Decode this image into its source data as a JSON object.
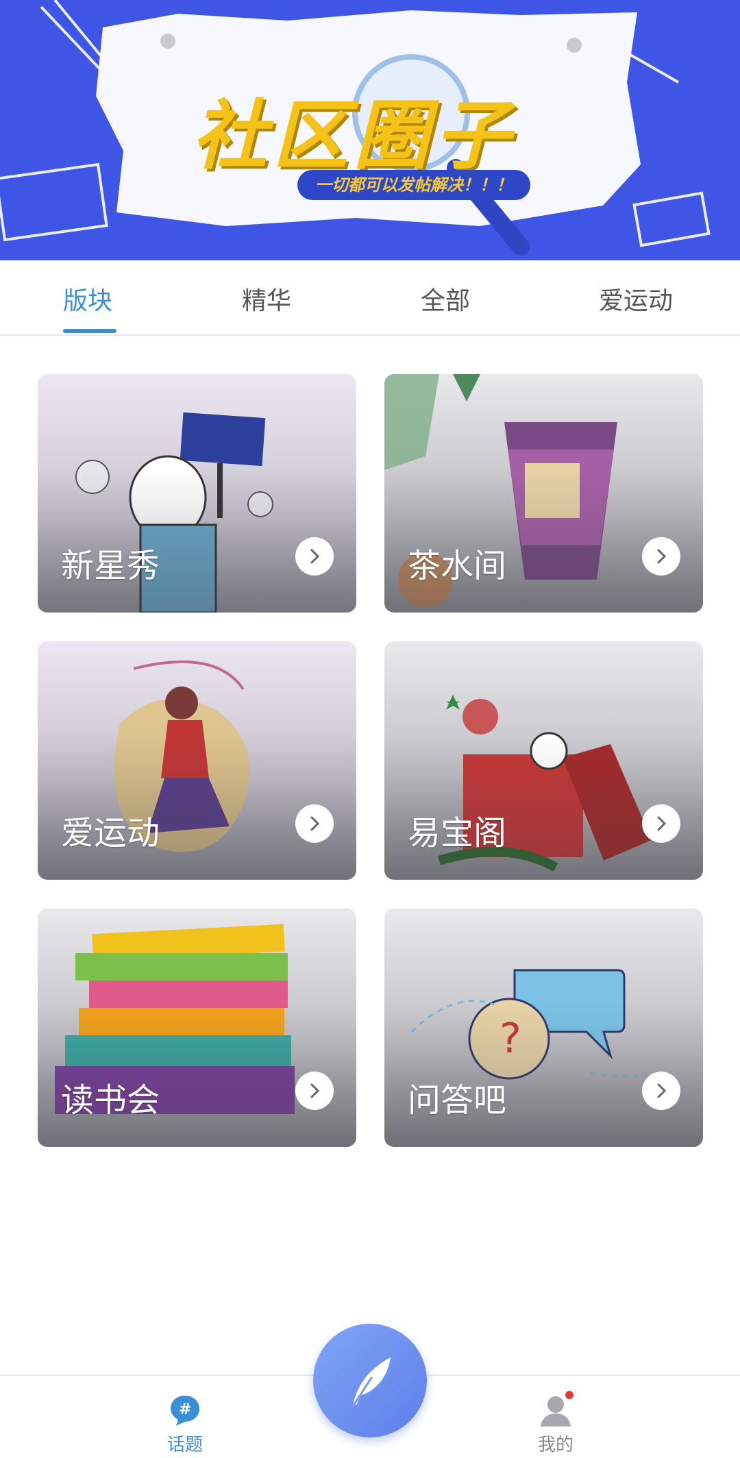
{
  "banner": {
    "title": "社区圈子",
    "slogan": "一切都可以发帖解决！！！"
  },
  "tabs": [
    {
      "label": "版块",
      "active": true
    },
    {
      "label": "精华",
      "active": false
    },
    {
      "label": "全部",
      "active": false
    },
    {
      "label": "爱运动",
      "active": false
    }
  ],
  "cards": [
    {
      "label": "新星秀"
    },
    {
      "label": "茶水间"
    },
    {
      "label": "爱运动"
    },
    {
      "label": "易宝阁"
    },
    {
      "label": "读书会"
    },
    {
      "label": "问答吧"
    }
  ],
  "bottom_nav": {
    "topics_label": "话题",
    "mine_label": "我的",
    "has_notification": true
  },
  "colors": {
    "accent": "#3b8fd6",
    "banner_bg": "#3f55e6",
    "title_yellow": "#f5c318",
    "notification_dot": "#e53935"
  },
  "icons": {
    "fab": "feather-quill-icon",
    "topics": "hashtag-chat-icon",
    "mine": "user-icon",
    "card_arrow": "chevron-right-icon"
  }
}
